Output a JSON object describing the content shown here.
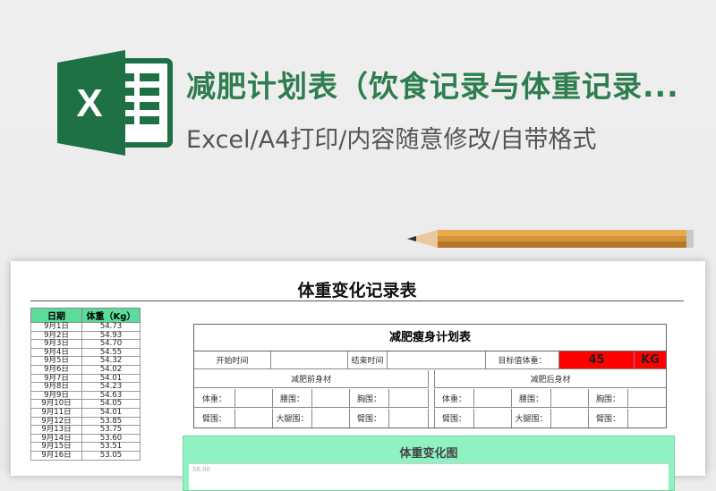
{
  "header": {
    "title": "减肥计划表（饮食记录与体重记录...",
    "subtitle": "Excel/A4打印/内容随意修改/自带格式",
    "logo_letter": "X",
    "logo_color": "#1e7145"
  },
  "sheet": {
    "title": "体重变化记录表",
    "weight_table": {
      "headers": [
        "日期",
        "体重（Kg）"
      ],
      "header_color": "#5cdc9c",
      "rows": [
        [
          "9月1日",
          "54.73"
        ],
        [
          "9月2日",
          "54.93"
        ],
        [
          "9月3日",
          "54.70"
        ],
        [
          "9月4日",
          "54.55"
        ],
        [
          "9月5日",
          "54.32"
        ],
        [
          "9月6日",
          "54.02"
        ],
        [
          "9月7日",
          "54.01"
        ],
        [
          "9月8日",
          "54.23"
        ],
        [
          "9月9日",
          "54.63"
        ],
        [
          "9月10日",
          "54.05"
        ],
        [
          "9月11日",
          "54.01"
        ],
        [
          "9月12日",
          "53.85"
        ],
        [
          "9月13日",
          "53.75"
        ],
        [
          "9月14日",
          "53.60"
        ],
        [
          "9月15日",
          "53.51"
        ],
        [
          "9月16日",
          "53.05"
        ]
      ]
    },
    "plan": {
      "title": "减肥瘦身计划表",
      "start_label": "开始时间",
      "end_label": "结束时间",
      "target_label": "目标值体重：",
      "target_value": "45",
      "target_unit": "KG",
      "target_color": "#ff0000",
      "before_label": "减肥前身材",
      "after_label": "减肥后身材",
      "weight_label": "体重：",
      "waist_label": "腰围：",
      "chest_label": "胸围：",
      "arm_label": "臂围：",
      "thigh_label": "大腿围："
    },
    "chart": {
      "title": "体重变化图",
      "top_tick": "56.00",
      "bg_color": "#8ff2c2"
    }
  }
}
